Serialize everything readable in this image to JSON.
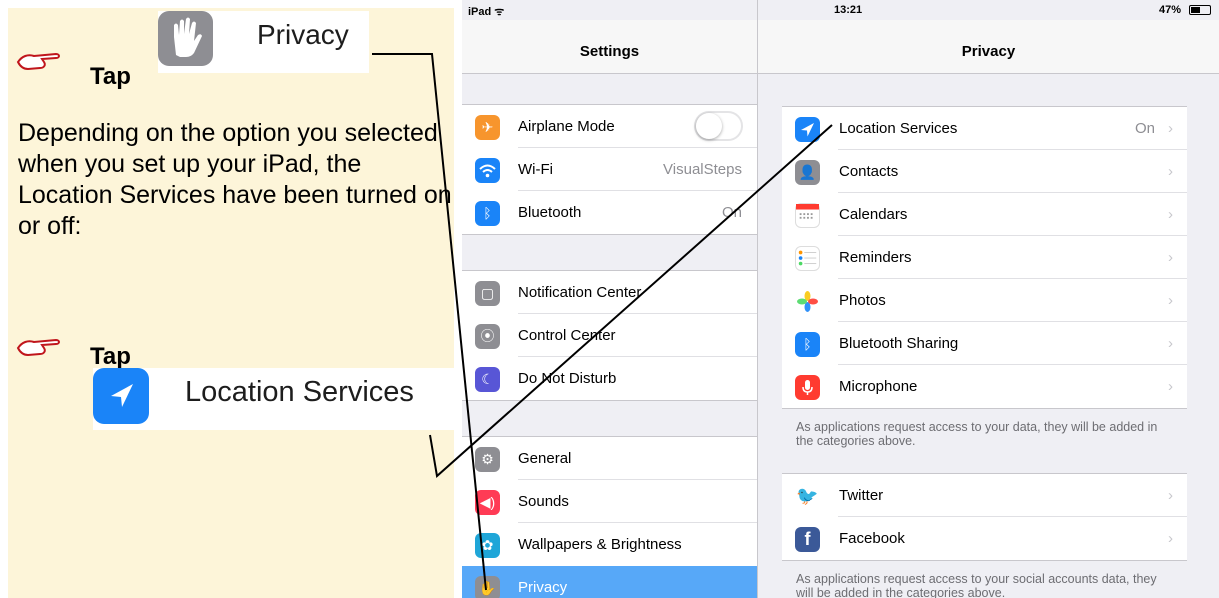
{
  "instructions": {
    "tap_label": "Tap",
    "privacy_label": "Privacy",
    "paragraph": "Depending on the option you selected when you set up your iPad, the Location Services have been turned on or off:",
    "location_services_label": "Location Services"
  },
  "status_bar": {
    "device": "iPad",
    "time": "13:21",
    "battery": "47%"
  },
  "settings": {
    "title": "Settings",
    "groups": [
      [
        {
          "label": "Airplane Mode",
          "icon": "airplane-icon",
          "color": "#f7952d",
          "value": "",
          "toggle": "off"
        },
        {
          "label": "Wi-Fi",
          "icon": "wifi-icon",
          "color": "#1a84f8",
          "value": "VisualSteps"
        },
        {
          "label": "Bluetooth",
          "icon": "bluetooth-icon",
          "color": "#1a84f8",
          "value": "On"
        }
      ],
      [
        {
          "label": "Notification Center",
          "icon": "notification-center-icon",
          "color": "#8e8e93",
          "value": ""
        },
        {
          "label": "Control Center",
          "icon": "control-center-icon",
          "color": "#8e8e93",
          "value": ""
        },
        {
          "label": "Do Not Disturb",
          "icon": "moon-icon",
          "color": "#5856d6",
          "value": ""
        }
      ],
      [
        {
          "label": "General",
          "icon": "gear-icon",
          "color": "#8e8e93",
          "value": ""
        },
        {
          "label": "Sounds",
          "icon": "speaker-icon",
          "color": "#ff3b55",
          "value": ""
        },
        {
          "label": "Wallpapers & Brightness",
          "icon": "wallpaper-icon",
          "color": "#1fa6d8",
          "value": ""
        },
        {
          "label": "Privacy",
          "icon": "hand-icon",
          "color": "#8e8e93",
          "value": "",
          "selected": true
        }
      ]
    ]
  },
  "privacy": {
    "title": "Privacy",
    "group1": [
      {
        "label": "Location Services",
        "icon": "location-arrow-icon",
        "color": "#1a84f8",
        "value": "On"
      },
      {
        "label": "Contacts",
        "icon": "contacts-icon",
        "color": "#8e8e93",
        "value": ""
      },
      {
        "label": "Calendars",
        "icon": "calendar-icon",
        "color": "#ffffff",
        "value": ""
      },
      {
        "label": "Reminders",
        "icon": "reminders-icon",
        "color": "#ffffff",
        "value": ""
      },
      {
        "label": "Photos",
        "icon": "photos-icon",
        "color": "#ffffff",
        "value": ""
      },
      {
        "label": "Bluetooth Sharing",
        "icon": "bluetooth-icon",
        "color": "#1a84f8",
        "value": ""
      },
      {
        "label": "Microphone",
        "icon": "microphone-icon",
        "color": "#ff3b30",
        "value": ""
      }
    ],
    "footer1": "As applications request access to your data, they will be added in the categories above.",
    "group2": [
      {
        "label": "Twitter",
        "icon": "twitter-icon",
        "color": "#ffffff",
        "value": ""
      },
      {
        "label": "Facebook",
        "icon": "facebook-icon",
        "color": "#3b5998",
        "value": ""
      }
    ],
    "footer2": "As applications request access to your social accounts data, they will be added in the categories above."
  }
}
